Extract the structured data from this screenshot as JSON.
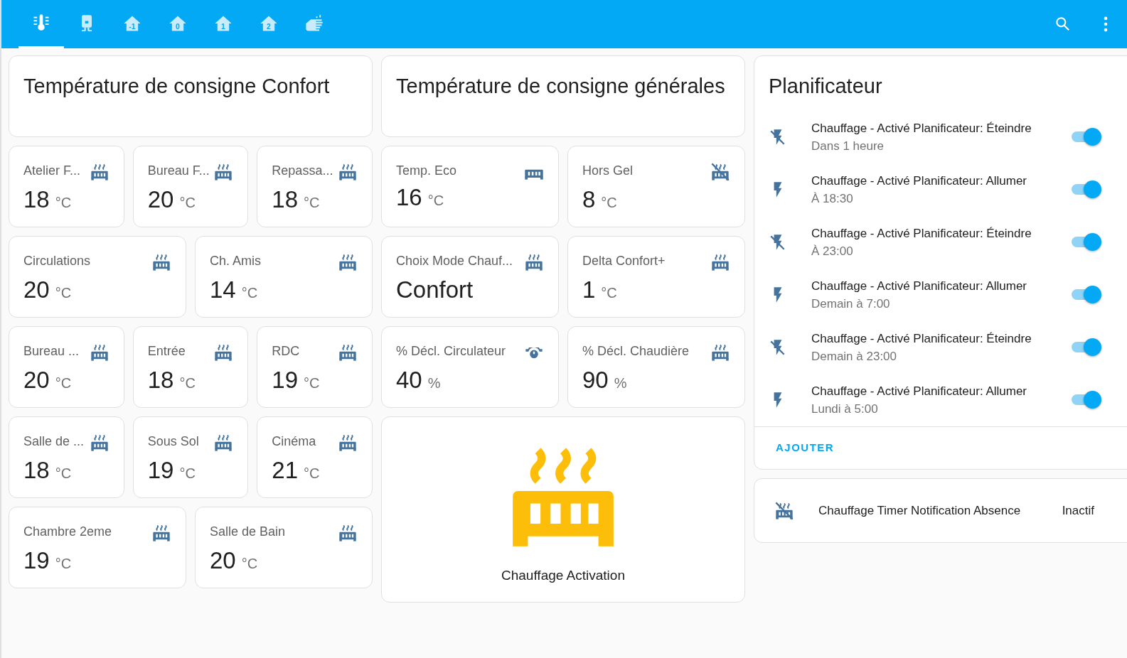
{
  "tabs": [
    {
      "kind": "thermometer",
      "selected": true
    },
    {
      "kind": "boiler",
      "selected": false
    },
    {
      "kind": "floor",
      "label": "-1",
      "selected": false
    },
    {
      "kind": "floor",
      "label": "0",
      "selected": false
    },
    {
      "kind": "floor",
      "label": "1",
      "selected": false
    },
    {
      "kind": "floor",
      "label": "2",
      "selected": false
    },
    {
      "kind": "washing",
      "selected": false
    }
  ],
  "columns": [
    {
      "title": "Température de consigne Confort",
      "rows": [
        [
          {
            "name": "Atelier F...",
            "value": "18",
            "unit": "°C",
            "kind": "heating"
          },
          {
            "name": "Bureau F...",
            "value": "20",
            "unit": "°C",
            "kind": "heating"
          },
          {
            "name": "Repassa...",
            "value": "18",
            "unit": "°C",
            "kind": "heating"
          }
        ],
        [
          {
            "name": "Circulations",
            "value": "20",
            "unit": "°C",
            "kind": "heating"
          },
          {
            "name": "Ch. Amis",
            "value": "14",
            "unit": "°C",
            "kind": "heating"
          }
        ],
        [
          {
            "name": "Bureau ...",
            "value": "20",
            "unit": "°C",
            "kind": "heating"
          },
          {
            "name": "Entrée",
            "value": "18",
            "unit": "°C",
            "kind": "heating"
          },
          {
            "name": "RDC",
            "value": "19",
            "unit": "°C",
            "kind": "heating"
          }
        ],
        [
          {
            "name": "Salle de ...",
            "value": "18",
            "unit": "°C",
            "kind": "heating"
          },
          {
            "name": "Sous Sol",
            "value": "19",
            "unit": "°C",
            "kind": "heating"
          },
          {
            "name": "Cinéma",
            "value": "21",
            "unit": "°C",
            "kind": "heating"
          }
        ],
        [
          {
            "name": "Chambre 2eme",
            "value": "19",
            "unit": "°C",
            "kind": "heating"
          },
          {
            "name": "Salle de Bain",
            "value": "20",
            "unit": "°C",
            "kind": "heating"
          }
        ]
      ]
    },
    {
      "title": "Température de consigne générales",
      "rows": [
        [
          {
            "name": "Temp. Eco",
            "value": "16",
            "unit": "°C",
            "kind": "cold"
          },
          {
            "name": "Hors Gel",
            "value": "8",
            "unit": "°C",
            "kind": "off"
          }
        ],
        [
          {
            "name": "Choix Mode Chauf...",
            "value": "Confort",
            "kind": "heating"
          },
          {
            "name": "Delta Confort+",
            "value": "1",
            "unit": "°C",
            "kind": "heating"
          }
        ],
        [
          {
            "name": "% Décl. Circulateur",
            "value": "40",
            "unit": "%",
            "kind": "pump"
          },
          {
            "name": "% Décl. Chaudière",
            "value": "90",
            "unit": "%",
            "kind": "heating"
          }
        ]
      ],
      "activation": {
        "label": "Chauffage Activation"
      }
    }
  ],
  "scheduler": {
    "title": "Planificateur",
    "items": [
      {
        "kind": "off",
        "name": "Chauffage - Activé Planificateur: Éteindre",
        "time": "Dans 1 heure",
        "on": true
      },
      {
        "kind": "on",
        "name": "Chauffage - Activé Planificateur: Allumer",
        "time": "À 18:30",
        "on": true
      },
      {
        "kind": "off",
        "name": "Chauffage - Activé Planificateur: Éteindre",
        "time": "À 23:00",
        "on": true
      },
      {
        "kind": "on",
        "name": "Chauffage - Activé Planificateur: Allumer",
        "time": "Demain à 7:00",
        "on": true
      },
      {
        "kind": "off",
        "name": "Chauffage - Activé Planificateur: Éteindre",
        "time": "Demain à 23:00",
        "on": true
      },
      {
        "kind": "on",
        "name": "Chauffage - Activé Planificateur: Allumer",
        "time": "Lundi à 5:00",
        "on": true
      }
    ],
    "add_button": "AJOUTER"
  },
  "timer": {
    "kind": "off",
    "name": "Chauffage Timer Notification Absence",
    "state": "Inactif"
  }
}
